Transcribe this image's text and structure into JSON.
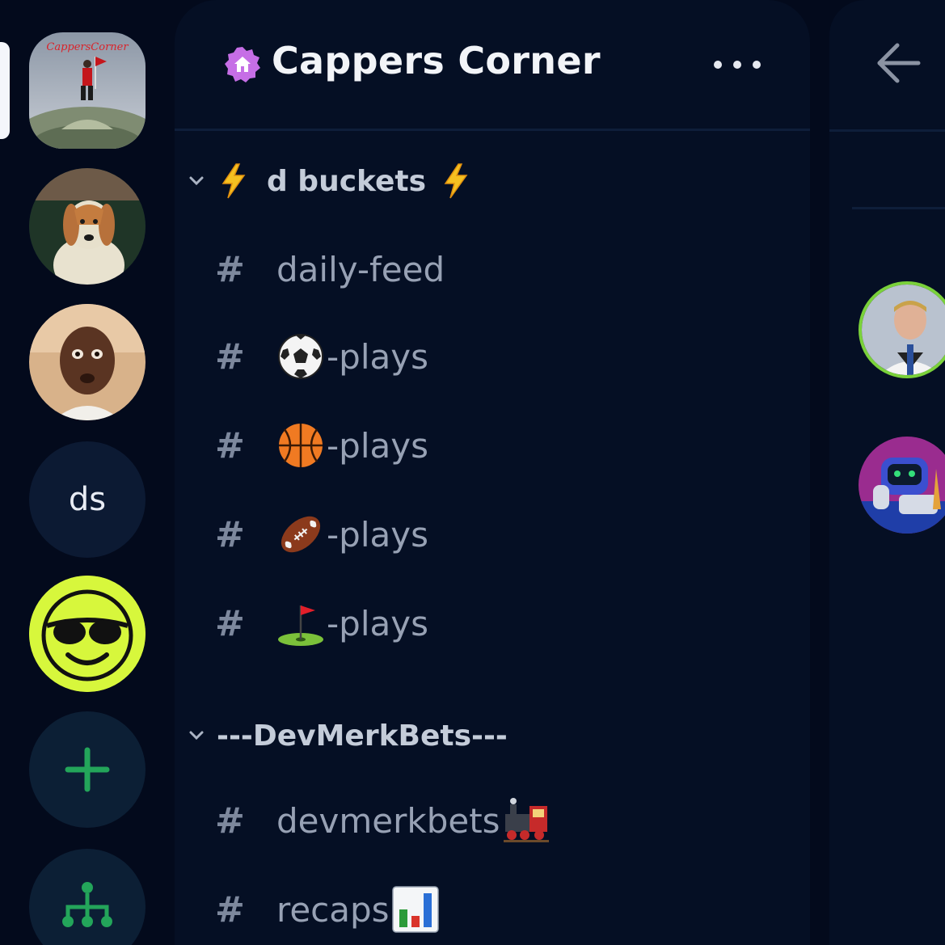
{
  "server_rail": {
    "active_server_banner": "CappersCorner",
    "servers": [
      {
        "name": "Cappers Corner",
        "kind": "image"
      },
      {
        "name": "dog avatar",
        "kind": "image"
      },
      {
        "name": "man avatar",
        "kind": "image"
      },
      {
        "name": "ds",
        "kind": "text",
        "label": "ds"
      },
      {
        "name": "sunglasses smiley",
        "kind": "image"
      },
      {
        "name": "add server",
        "kind": "icon",
        "icon": "plus-icon"
      },
      {
        "name": "discover",
        "kind": "icon",
        "icon": "hub-icon"
      }
    ]
  },
  "header": {
    "server_name": "Cappers Corner",
    "badge_icon": "home-badge-icon",
    "more_icon": "more-dots-icon"
  },
  "categories": [
    {
      "label": "d buckets",
      "label_prefix_icon": "lightning-icon",
      "label_suffix_icon": "lightning-icon",
      "channels": [
        {
          "prefix": "#",
          "emoji": "",
          "name": "daily-feed"
        },
        {
          "prefix": "#",
          "emoji": "soccer-ball-icon",
          "name": "-plays"
        },
        {
          "prefix": "#",
          "emoji": "basketball-icon",
          "name": "-plays"
        },
        {
          "prefix": "#",
          "emoji": "football-icon",
          "name": "-plays"
        },
        {
          "prefix": "#",
          "emoji": "golf-flag-icon",
          "name": "-plays"
        }
      ]
    },
    {
      "label": "---DevMerkBets---",
      "channels": [
        {
          "prefix": "#",
          "name": "devmerkbets",
          "emoji_after": "train-icon"
        },
        {
          "prefix": "#",
          "name": "recaps",
          "emoji_after": "bar-chart-icon"
        }
      ]
    }
  ],
  "right_panel": {
    "back_icon": "back-arrow-icon",
    "members": [
      "player avatar",
      "robot avatar"
    ]
  },
  "colors": {
    "background": "#030a1c",
    "panel": "#050f24",
    "accent_green": "#23a55a",
    "text_primary": "#f2f4f8",
    "text_muted": "#97a1b4"
  }
}
